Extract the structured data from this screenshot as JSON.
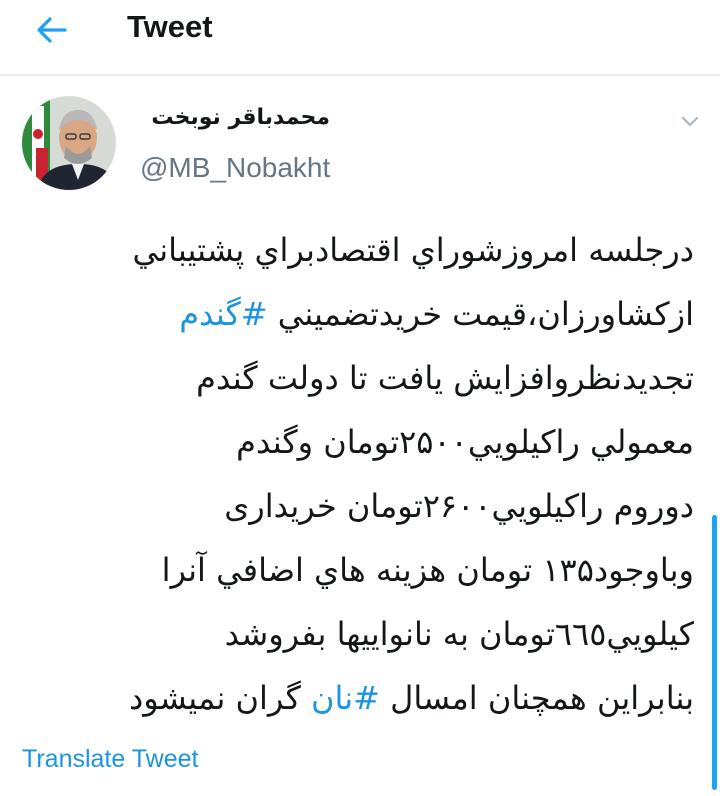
{
  "header": {
    "title": "Tweet",
    "back_icon": "arrow-left-icon",
    "accent_color": "#1da1f2"
  },
  "author": {
    "name": "محمدباقر نوبخت",
    "handle": "@MB_Nobakht",
    "avatar_icon": "profile-photo"
  },
  "menu_icon": "chevron-down-icon",
  "tweet": {
    "lines": [
      {
        "text": "درجلسه امروزشوراي اقتصادبراي پشتيباني"
      },
      {
        "text": "ازكشاورزان،قيمت خريدتضميني ",
        "hashtag": "#گندم"
      },
      {
        "text": "تجديدنظروافزايش يافت تا دولت گندم"
      },
      {
        "text": "معمولي راكيلويي۲۵۰۰تومان وگندم"
      },
      {
        "text": "دوروم راكيلويي۲۶۰۰تومان خريداری"
      },
      {
        "text": "وباوجود۱۳۵ تومان هزينه هاي اضافي آنرا"
      },
      {
        "text": "كيلويي٦٦٥تومان به نانواييها بفروشد"
      },
      {
        "text": "بنابراين همچنان امسال ",
        "hashtag": "#نان",
        "text_after": " گران نميشود"
      }
    ],
    "hashtag_color": "#1b95e0"
  },
  "translate_label": "Translate Tweet"
}
